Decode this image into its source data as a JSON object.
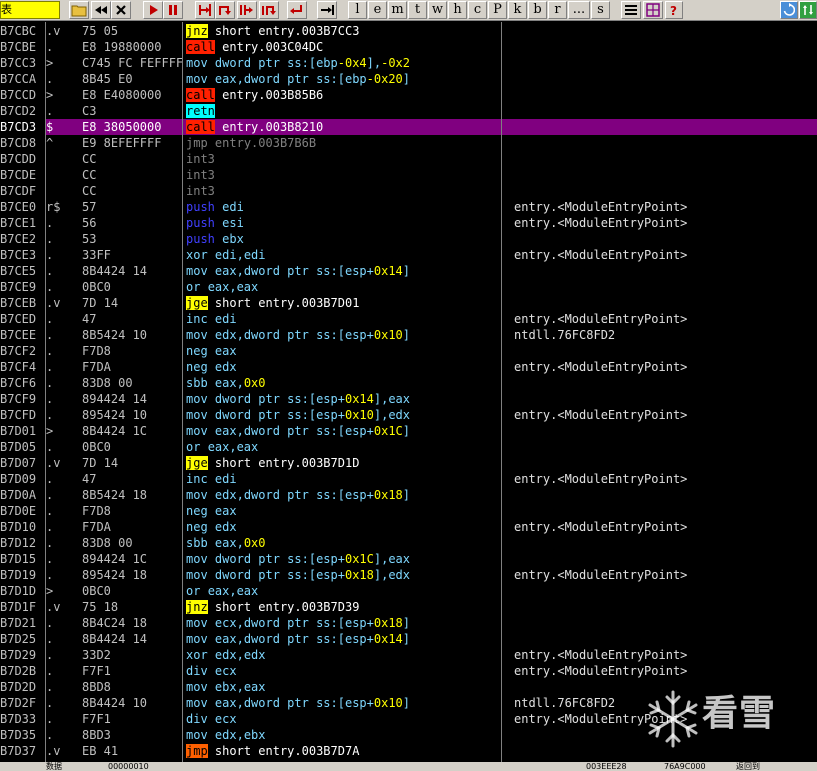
{
  "colors": {
    "bg": "#000000",
    "default_text": "#c0c0c0",
    "mnemonic": "#7fd8ff",
    "operand": "#ffffff",
    "number": "#ffff00",
    "selected_bg": "#800080",
    "jump_bg": "#ffff00",
    "call_bg": "#ff2000",
    "retn_bg": "#00ffff",
    "jmp_bg": "#ff6000",
    "push_text": "#4040ff",
    "int3_text": "#808080",
    "comment_text": "#e0e0e0"
  },
  "toolbar": {
    "yellow_label": "表",
    "buttons": [
      {
        "name": "open-button",
        "icon": "folder-icon"
      },
      {
        "name": "rewind-button",
        "icon": "rewind-icon"
      },
      {
        "name": "close-button",
        "icon": "close-icon"
      },
      {
        "name": "run-button",
        "icon": "play-icon"
      },
      {
        "name": "pause-button",
        "icon": "pause-icon"
      },
      {
        "name": "step-into-button",
        "icon": "step-into-icon"
      },
      {
        "name": "step-over-button",
        "icon": "step-over-icon"
      },
      {
        "name": "trace-into-button",
        "icon": "trace-into-icon"
      },
      {
        "name": "trace-over-button",
        "icon": "trace-over-icon"
      },
      {
        "name": "execute-till-return-button",
        "icon": "return-icon"
      },
      {
        "name": "goto-button",
        "icon": "goto-icon"
      }
    ],
    "letters": [
      "l",
      "e",
      "m",
      "t",
      "w",
      "h",
      "c",
      "P",
      "k",
      "b",
      "r",
      "...",
      "s"
    ]
  },
  "rows": [
    {
      "addr": "B7CBC",
      "mark": ".v",
      "hex": "75 05",
      "mn": "jnz",
      "op": "short entry.003B7CC3",
      "cmt": "",
      "kind": "jcc"
    },
    {
      "addr": "B7CBE",
      "mark": ".",
      "hex": "E8 19880000",
      "mn": "call",
      "op": "entry.003C04DC",
      "cmt": "",
      "kind": "call"
    },
    {
      "addr": "B7CC3",
      "mark": ">",
      "hex": "C745 FC FEFFFF",
      "mn": "mov",
      "op": "dword ptr ss:[ebp-0x4],-0x2",
      "cmt": "",
      "kind": "mov"
    },
    {
      "addr": "B7CCA",
      "mark": ".",
      "hex": "8B45 E0",
      "mn": "mov",
      "op": "eax,dword ptr ss:[ebp-0x20]",
      "cmt": "",
      "kind": "mov"
    },
    {
      "addr": "B7CCD",
      "mark": ">",
      "hex": "E8 E4080000",
      "mn": "call",
      "op": "entry.003B85B6",
      "cmt": "",
      "kind": "call"
    },
    {
      "addr": "B7CD2",
      "mark": ".",
      "hex": "C3",
      "mn": "retn",
      "op": "",
      "cmt": "",
      "kind": "retn"
    },
    {
      "addr": "B7CD3",
      "mark": "$",
      "hex": "E8 38050000",
      "mn": "call",
      "op": "entry.003B8210",
      "cmt": "",
      "kind": "call",
      "sel": true
    },
    {
      "addr": "B7CD8",
      "mark": "^",
      "hex": "E9 8EFEFFFF",
      "mn": "jmp",
      "op": "entry.003B7B6B",
      "cmt": "",
      "kind": "dimjmp"
    },
    {
      "addr": "B7CDD",
      "mark": "",
      "hex": "CC",
      "mn": "int3",
      "op": "",
      "cmt": "",
      "kind": "int3"
    },
    {
      "addr": "B7CDE",
      "mark": "",
      "hex": "CC",
      "mn": "int3",
      "op": "",
      "cmt": "",
      "kind": "int3"
    },
    {
      "addr": "B7CDF",
      "mark": "",
      "hex": "CC",
      "mn": "int3",
      "op": "",
      "cmt": "",
      "kind": "int3"
    },
    {
      "addr": "B7CE0",
      "mark": "r$",
      "hex": "57",
      "mn": "push",
      "op": "edi",
      "cmt": "entry.<ModuleEntryPoint>",
      "kind": "push"
    },
    {
      "addr": "B7CE1",
      "mark": ".",
      "hex": "56",
      "mn": "push",
      "op": "esi",
      "cmt": "entry.<ModuleEntryPoint>",
      "kind": "push"
    },
    {
      "addr": "B7CE2",
      "mark": ".",
      "hex": "53",
      "mn": "push",
      "op": "ebx",
      "cmt": "",
      "kind": "push"
    },
    {
      "addr": "B7CE3",
      "mark": ".",
      "hex": "33FF",
      "mn": "xor",
      "op": "edi,edi",
      "cmt": "entry.<ModuleEntryPoint>",
      "kind": "mov"
    },
    {
      "addr": "B7CE5",
      "mark": ".",
      "hex": "8B4424 14",
      "mn": "mov",
      "op": "eax,dword ptr ss:[esp+0x14]",
      "cmt": "",
      "kind": "mov"
    },
    {
      "addr": "B7CE9",
      "mark": ".",
      "hex": "0BC0",
      "mn": "or",
      "op": "eax,eax",
      "cmt": "",
      "kind": "mov"
    },
    {
      "addr": "B7CEB",
      "mark": ".v",
      "hex": "7D 14",
      "mn": "jge",
      "op": "short entry.003B7D01",
      "cmt": "",
      "kind": "jcc"
    },
    {
      "addr": "B7CED",
      "mark": ".",
      "hex": "47",
      "mn": "inc",
      "op": "edi",
      "cmt": "entry.<ModuleEntryPoint>",
      "kind": "mov"
    },
    {
      "addr": "B7CEE",
      "mark": ".",
      "hex": "8B5424 10",
      "mn": "mov",
      "op": "edx,dword ptr ss:[esp+0x10]",
      "cmt": "ntdll.76FC8FD2",
      "kind": "mov"
    },
    {
      "addr": "B7CF2",
      "mark": ".",
      "hex": "F7D8",
      "mn": "neg",
      "op": "eax",
      "cmt": "",
      "kind": "mov"
    },
    {
      "addr": "B7CF4",
      "mark": ".",
      "hex": "F7DA",
      "mn": "neg",
      "op": "edx",
      "cmt": "entry.<ModuleEntryPoint>",
      "kind": "mov"
    },
    {
      "addr": "B7CF6",
      "mark": ".",
      "hex": "83D8 00",
      "mn": "sbb",
      "op": "eax,0x0",
      "cmt": "",
      "kind": "mov"
    },
    {
      "addr": "B7CF9",
      "mark": ".",
      "hex": "894424 14",
      "mn": "mov",
      "op": "dword ptr ss:[esp+0x14],eax",
      "cmt": "",
      "kind": "mov"
    },
    {
      "addr": "B7CFD",
      "mark": ".",
      "hex": "895424 10",
      "mn": "mov",
      "op": "dword ptr ss:[esp+0x10],edx",
      "cmt": "entry.<ModuleEntryPoint>",
      "kind": "mov"
    },
    {
      "addr": "B7D01",
      "mark": ">",
      "hex": "8B4424 1C",
      "mn": "mov",
      "op": "eax,dword ptr ss:[esp+0x1C]",
      "cmt": "",
      "kind": "mov"
    },
    {
      "addr": "B7D05",
      "mark": ".",
      "hex": "0BC0",
      "mn": "or",
      "op": "eax,eax",
      "cmt": "",
      "kind": "mov"
    },
    {
      "addr": "B7D07",
      "mark": ".v",
      "hex": "7D 14",
      "mn": "jge",
      "op": "short entry.003B7D1D",
      "cmt": "",
      "kind": "jcc"
    },
    {
      "addr": "B7D09",
      "mark": ".",
      "hex": "47",
      "mn": "inc",
      "op": "edi",
      "cmt": "entry.<ModuleEntryPoint>",
      "kind": "mov"
    },
    {
      "addr": "B7D0A",
      "mark": ".",
      "hex": "8B5424 18",
      "mn": "mov",
      "op": "edx,dword ptr ss:[esp+0x18]",
      "cmt": "",
      "kind": "mov"
    },
    {
      "addr": "B7D0E",
      "mark": ".",
      "hex": "F7D8",
      "mn": "neg",
      "op": "eax",
      "cmt": "",
      "kind": "mov"
    },
    {
      "addr": "B7D10",
      "mark": ".",
      "hex": "F7DA",
      "mn": "neg",
      "op": "edx",
      "cmt": "entry.<ModuleEntryPoint>",
      "kind": "mov"
    },
    {
      "addr": "B7D12",
      "mark": ".",
      "hex": "83D8 00",
      "mn": "sbb",
      "op": "eax,0x0",
      "cmt": "",
      "kind": "mov"
    },
    {
      "addr": "B7D15",
      "mark": ".",
      "hex": "894424 1C",
      "mn": "mov",
      "op": "dword ptr ss:[esp+0x1C],eax",
      "cmt": "",
      "kind": "mov"
    },
    {
      "addr": "B7D19",
      "mark": ".",
      "hex": "895424 18",
      "mn": "mov",
      "op": "dword ptr ss:[esp+0x18],edx",
      "cmt": "entry.<ModuleEntryPoint>",
      "kind": "mov"
    },
    {
      "addr": "B7D1D",
      "mark": ">",
      "hex": "0BC0",
      "mn": "or",
      "op": "eax,eax",
      "cmt": "",
      "kind": "mov"
    },
    {
      "addr": "B7D1F",
      "mark": ".v",
      "hex": "75 18",
      "mn": "jnz",
      "op": "short entry.003B7D39",
      "cmt": "",
      "kind": "jcc"
    },
    {
      "addr": "B7D21",
      "mark": ".",
      "hex": "8B4C24 18",
      "mn": "mov",
      "op": "ecx,dword ptr ss:[esp+0x18]",
      "cmt": "",
      "kind": "mov"
    },
    {
      "addr": "B7D25",
      "mark": ".",
      "hex": "8B4424 14",
      "mn": "mov",
      "op": "eax,dword ptr ss:[esp+0x14]",
      "cmt": "",
      "kind": "mov"
    },
    {
      "addr": "B7D29",
      "mark": ".",
      "hex": "33D2",
      "mn": "xor",
      "op": "edx,edx",
      "cmt": "entry.<ModuleEntryPoint>",
      "kind": "mov"
    },
    {
      "addr": "B7D2B",
      "mark": ".",
      "hex": "F7F1",
      "mn": "div",
      "op": "ecx",
      "cmt": "entry.<ModuleEntryPoint>",
      "kind": "mov"
    },
    {
      "addr": "B7D2D",
      "mark": ".",
      "hex": "8BD8",
      "mn": "mov",
      "op": "ebx,eax",
      "cmt": "",
      "kind": "mov"
    },
    {
      "addr": "B7D2F",
      "mark": ".",
      "hex": "8B4424 10",
      "mn": "mov",
      "op": "eax,dword ptr ss:[esp+0x10]",
      "cmt": "ntdll.76FC8FD2",
      "kind": "mov"
    },
    {
      "addr": "B7D33",
      "mark": ".",
      "hex": "F7F1",
      "mn": "div",
      "op": "ecx",
      "cmt": "entry.<ModuleEntryPoint>",
      "kind": "mov"
    },
    {
      "addr": "B7D35",
      "mark": ".",
      "hex": "8BD3",
      "mn": "mov",
      "op": "edx,ebx",
      "cmt": "",
      "kind": "mov"
    },
    {
      "addr": "B7D37",
      "mark": ".v",
      "hex": "EB 41",
      "mn": "jmp",
      "op": "short entry.003B7D7A",
      "cmt": "",
      "kind": "jmp"
    }
  ],
  "statusbar": {
    "left1": "数据",
    "left2": "00000010",
    "right1": "003EEE28",
    "right2": "76A9C000",
    "right3": "返回到"
  },
  "watermark": {
    "text": "看雪"
  }
}
